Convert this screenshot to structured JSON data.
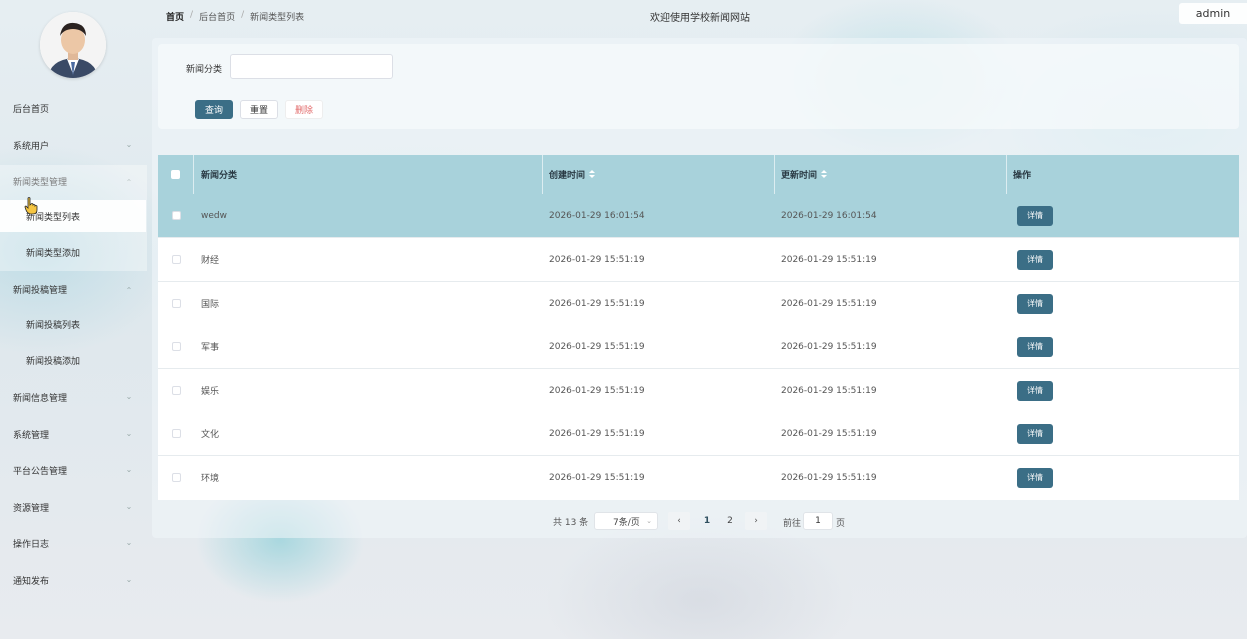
{
  "user": {
    "name": "admin"
  },
  "header": {
    "breadcrumb": [
      "首页",
      "后台首页",
      "新闻类型列表"
    ],
    "site_title": "欢迎使用学校新闻网站"
  },
  "sidebar": {
    "items": [
      {
        "label": "后台首页",
        "expandable": false
      },
      {
        "label": "系统用户",
        "expandable": true,
        "expanded": false
      },
      {
        "label": "新闻类型管理",
        "expandable": true,
        "expanded": true,
        "children": [
          {
            "label": "新闻类型列表",
            "active": true
          },
          {
            "label": "新闻类型添加",
            "active": false
          }
        ]
      },
      {
        "label": "新闻投稿管理",
        "expandable": true,
        "expanded": true,
        "children": [
          {
            "label": "新闻投稿列表"
          },
          {
            "label": "新闻投稿添加"
          }
        ]
      },
      {
        "label": "新闻信息管理",
        "expandable": true,
        "expanded": false
      },
      {
        "label": "系统管理",
        "expandable": true,
        "expanded": false
      },
      {
        "label": "平台公告管理",
        "expandable": true,
        "expanded": false
      },
      {
        "label": "资源管理",
        "expandable": true,
        "expanded": false
      },
      {
        "label": "操作日志",
        "expandable": true,
        "expanded": false
      },
      {
        "label": "通知发布",
        "expandable": true,
        "expanded": false
      }
    ]
  },
  "search": {
    "label": "新闻分类",
    "value": "",
    "placeholder": "",
    "query_label": "查询",
    "reset_label": "重置",
    "delete_label": "删除"
  },
  "table": {
    "columns": [
      "新闻分类",
      "创建时间",
      "更新时间",
      "操作"
    ],
    "detail_label": "详情",
    "rows": [
      {
        "name": "wedw",
        "created": "2026-01-29 16:01:54",
        "updated": "2026-01-29 16:01:54"
      },
      {
        "name": "财经",
        "created": "2026-01-29 15:51:19",
        "updated": "2026-01-29 15:51:19"
      },
      {
        "name": "国际",
        "created": "2026-01-29 15:51:19",
        "updated": "2026-01-29 15:51:19"
      },
      {
        "name": "军事",
        "created": "2026-01-29 15:51:19",
        "updated": "2026-01-29 15:51:19"
      },
      {
        "name": "娱乐",
        "created": "2026-01-29 15:51:19",
        "updated": "2026-01-29 15:51:19"
      },
      {
        "name": "文化",
        "created": "2026-01-29 15:51:19",
        "updated": "2026-01-29 15:51:19"
      },
      {
        "name": "环境",
        "created": "2026-01-29 15:51:19",
        "updated": "2026-01-29 15:51:19"
      }
    ]
  },
  "pagination": {
    "total_text": "共 13 条",
    "page_size": "7条/页",
    "prev_icon": "chevron-left-icon",
    "next_icon": "chevron-right-icon",
    "pages": [
      "1",
      "2"
    ],
    "current_page": "1",
    "goto_label": "前往",
    "goto_value": "1",
    "page_suffix": "页"
  },
  "colors": {
    "accent": "#3b6e86",
    "table_header": "#a8d2db",
    "delete_text": "#e26a6a"
  }
}
